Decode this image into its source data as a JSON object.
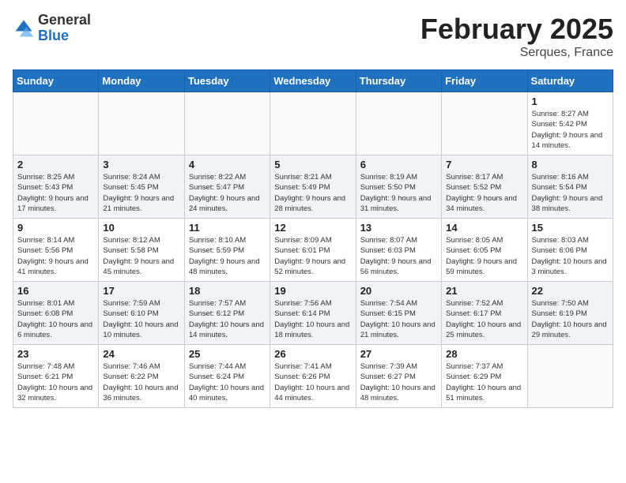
{
  "header": {
    "logo_general": "General",
    "logo_blue": "Blue",
    "month_title": "February 2025",
    "location": "Serques, France"
  },
  "days_of_week": [
    "Sunday",
    "Monday",
    "Tuesday",
    "Wednesday",
    "Thursday",
    "Friday",
    "Saturday"
  ],
  "weeks": [
    {
      "shaded": false,
      "days": [
        {
          "date": "",
          "info": ""
        },
        {
          "date": "",
          "info": ""
        },
        {
          "date": "",
          "info": ""
        },
        {
          "date": "",
          "info": ""
        },
        {
          "date": "",
          "info": ""
        },
        {
          "date": "",
          "info": ""
        },
        {
          "date": "1",
          "info": "Sunrise: 8:27 AM\nSunset: 5:42 PM\nDaylight: 9 hours and 14 minutes."
        }
      ]
    },
    {
      "shaded": true,
      "days": [
        {
          "date": "2",
          "info": "Sunrise: 8:25 AM\nSunset: 5:43 PM\nDaylight: 9 hours and 17 minutes."
        },
        {
          "date": "3",
          "info": "Sunrise: 8:24 AM\nSunset: 5:45 PM\nDaylight: 9 hours and 21 minutes."
        },
        {
          "date": "4",
          "info": "Sunrise: 8:22 AM\nSunset: 5:47 PM\nDaylight: 9 hours and 24 minutes."
        },
        {
          "date": "5",
          "info": "Sunrise: 8:21 AM\nSunset: 5:49 PM\nDaylight: 9 hours and 28 minutes."
        },
        {
          "date": "6",
          "info": "Sunrise: 8:19 AM\nSunset: 5:50 PM\nDaylight: 9 hours and 31 minutes."
        },
        {
          "date": "7",
          "info": "Sunrise: 8:17 AM\nSunset: 5:52 PM\nDaylight: 9 hours and 34 minutes."
        },
        {
          "date": "8",
          "info": "Sunrise: 8:16 AM\nSunset: 5:54 PM\nDaylight: 9 hours and 38 minutes."
        }
      ]
    },
    {
      "shaded": false,
      "days": [
        {
          "date": "9",
          "info": "Sunrise: 8:14 AM\nSunset: 5:56 PM\nDaylight: 9 hours and 41 minutes."
        },
        {
          "date": "10",
          "info": "Sunrise: 8:12 AM\nSunset: 5:58 PM\nDaylight: 9 hours and 45 minutes."
        },
        {
          "date": "11",
          "info": "Sunrise: 8:10 AM\nSunset: 5:59 PM\nDaylight: 9 hours and 48 minutes."
        },
        {
          "date": "12",
          "info": "Sunrise: 8:09 AM\nSunset: 6:01 PM\nDaylight: 9 hours and 52 minutes."
        },
        {
          "date": "13",
          "info": "Sunrise: 8:07 AM\nSunset: 6:03 PM\nDaylight: 9 hours and 56 minutes."
        },
        {
          "date": "14",
          "info": "Sunrise: 8:05 AM\nSunset: 6:05 PM\nDaylight: 9 hours and 59 minutes."
        },
        {
          "date": "15",
          "info": "Sunrise: 8:03 AM\nSunset: 6:06 PM\nDaylight: 10 hours and 3 minutes."
        }
      ]
    },
    {
      "shaded": true,
      "days": [
        {
          "date": "16",
          "info": "Sunrise: 8:01 AM\nSunset: 6:08 PM\nDaylight: 10 hours and 6 minutes."
        },
        {
          "date": "17",
          "info": "Sunrise: 7:59 AM\nSunset: 6:10 PM\nDaylight: 10 hours and 10 minutes."
        },
        {
          "date": "18",
          "info": "Sunrise: 7:57 AM\nSunset: 6:12 PM\nDaylight: 10 hours and 14 minutes."
        },
        {
          "date": "19",
          "info": "Sunrise: 7:56 AM\nSunset: 6:14 PM\nDaylight: 10 hours and 18 minutes."
        },
        {
          "date": "20",
          "info": "Sunrise: 7:54 AM\nSunset: 6:15 PM\nDaylight: 10 hours and 21 minutes."
        },
        {
          "date": "21",
          "info": "Sunrise: 7:52 AM\nSunset: 6:17 PM\nDaylight: 10 hours and 25 minutes."
        },
        {
          "date": "22",
          "info": "Sunrise: 7:50 AM\nSunset: 6:19 PM\nDaylight: 10 hours and 29 minutes."
        }
      ]
    },
    {
      "shaded": false,
      "days": [
        {
          "date": "23",
          "info": "Sunrise: 7:48 AM\nSunset: 6:21 PM\nDaylight: 10 hours and 32 minutes."
        },
        {
          "date": "24",
          "info": "Sunrise: 7:46 AM\nSunset: 6:22 PM\nDaylight: 10 hours and 36 minutes."
        },
        {
          "date": "25",
          "info": "Sunrise: 7:44 AM\nSunset: 6:24 PM\nDaylight: 10 hours and 40 minutes."
        },
        {
          "date": "26",
          "info": "Sunrise: 7:41 AM\nSunset: 6:26 PM\nDaylight: 10 hours and 44 minutes."
        },
        {
          "date": "27",
          "info": "Sunrise: 7:39 AM\nSunset: 6:27 PM\nDaylight: 10 hours and 48 minutes."
        },
        {
          "date": "28",
          "info": "Sunrise: 7:37 AM\nSunset: 6:29 PM\nDaylight: 10 hours and 51 minutes."
        },
        {
          "date": "",
          "info": ""
        }
      ]
    }
  ]
}
